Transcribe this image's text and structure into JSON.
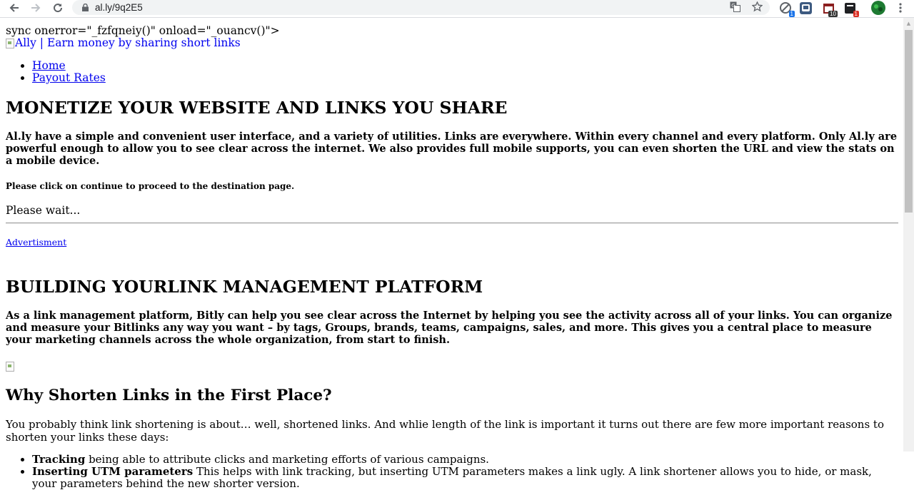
{
  "browser": {
    "url": "al.ly/9q2E5",
    "extension_badges": [
      "1",
      "10",
      "1"
    ]
  },
  "page": {
    "raw_text": "sync onerror=\"_fzfqneiy()\" onload=\"_ouancv()\">",
    "logo_alt": "Ally | Earn money by sharing short links",
    "nav": [
      "Home",
      "Payout Rates"
    ],
    "heading1": "MONETIZE YOUR WEBSITE AND LINKS YOU SHARE",
    "intro": "Al.ly have a simple and convenient user interface, and a variety of utilities. Links are everywhere. Within every channel and every platform. Only Al.ly are powerful enough to allow you to see clear across the internet. We also provides full mobile supports, you can even shorten the URL and view the stats on a mobile device.",
    "instruction": "Please click on continue to proceed to the destination page.",
    "wait": "Please wait...",
    "ad_link": "Advertisment",
    "heading2": "BUILDING YOURLINK MANAGEMENT PLATFORM",
    "platform_text": "As a link management platform, Bitly can help you see clear across the Internet by helping you see the activity across all of your links. You can organize and measure your Bitlinks any way you want – by tags, Groups, brands, teams, campaigns, sales, and more. This gives you a central place to measure your marketing channels across the whole organization, from start to finish.",
    "heading3": "Why Shorten Links in the First Place?",
    "why_text": "You probably think link shortening is about… well, shortened links. And whlie length of the link is important it turns out there are few more important reasons to shorten your links these days:",
    "features": [
      {
        "title": "Tracking",
        "text": " being able to attribute clicks and marketing efforts of various campaigns."
      },
      {
        "title": "Inserting UTM parameters",
        "text": " This helps with link tracking, but inserting UTM parameters makes a link ugly. A link shortener allows you to hide, or mask, your parameters behind the new shorter version."
      }
    ]
  },
  "colors": {
    "link": "#0000ee",
    "chrome_bg": "#f1f3f4"
  }
}
